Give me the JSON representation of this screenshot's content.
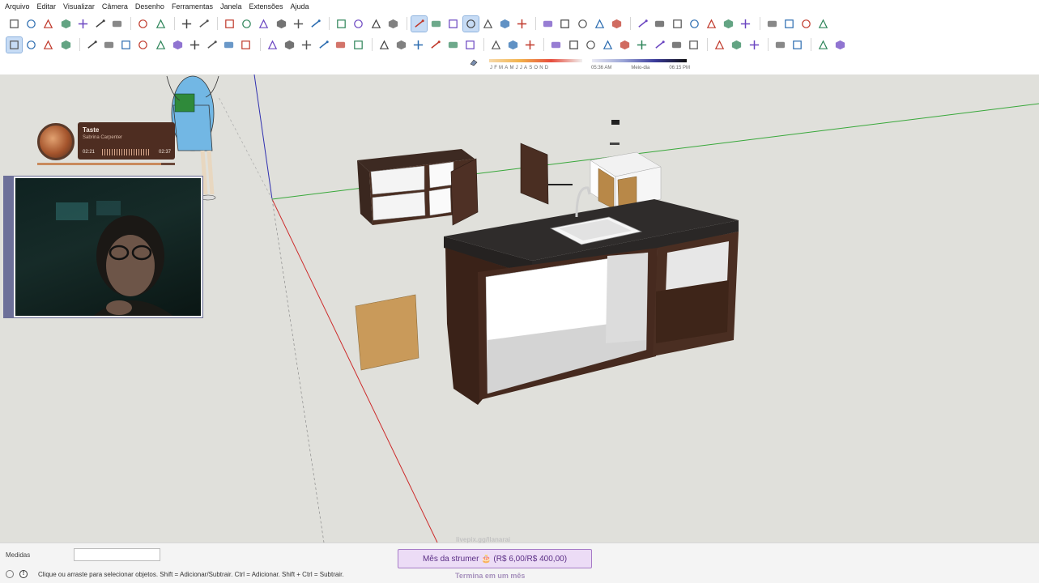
{
  "menu": [
    "Arquivo",
    "Editar",
    "Visualizar",
    "Câmera",
    "Desenho",
    "Ferramentas",
    "Janela",
    "Extensões",
    "Ajuda"
  ],
  "toolbar_top": [
    "new-file-icon",
    "open-folder-icon",
    "save-icon",
    "cut-icon",
    "copy-icon",
    "paste-icon",
    "erase-icon",
    "sep",
    "undo-icon",
    "redo-icon",
    "sep",
    "print-icon",
    "model-info-icon",
    "sep",
    "iso-view-icon",
    "top-view-icon",
    "front-view-icon",
    "right-view-icon",
    "back-view-icon",
    "left-view-icon",
    "sep",
    "orbit-icon",
    "pan-icon",
    "zoom-extents-icon",
    "section-plane-icon",
    "sep",
    "xray-icon",
    "back-edges-icon",
    "wireframe-icon",
    "hidden-line-icon",
    "shaded-icon",
    "textured-icon",
    "monochrome-icon",
    "sep",
    "solid-union-icon",
    "solid-subtract-icon",
    "solid-intersect-icon",
    "solid-trim-icon",
    "solid-split-icon",
    "sep",
    "warehouse-icon",
    "extension-icon",
    "component-icon",
    "material-icon",
    "style-icon",
    "cloud-icon",
    "settings-icon",
    "sep",
    "layout-icon",
    "info-icon",
    "cart-icon",
    "account-icon"
  ],
  "toolbar_bottom": [
    "select-icon",
    "component-icon",
    "paint-bucket-icon",
    "eraser-icon",
    "sep",
    "pencil-icon",
    "freehand-icon",
    "rectangle-icon",
    "rotated-rectangle-icon",
    "circle-icon",
    "polygon-icon",
    "arc-icon",
    "two-point-arc-icon",
    "three-point-arc-icon",
    "pie-icon",
    "sep",
    "move-icon",
    "push-pull-icon",
    "rotate-icon",
    "follow-me-icon",
    "scale-icon",
    "offset-icon",
    "sep",
    "tape-measure-icon",
    "dimension-icon",
    "protractor-icon",
    "text-icon",
    "axes-icon",
    "3d-text-icon",
    "sep",
    "sandbox-icon",
    "stamp-icon",
    "drape-icon",
    "sep",
    "section-icon",
    "section-cut-icon",
    "zoom-icon",
    "zoom-window-icon",
    "zoom-extents-icon",
    "previous-view-icon",
    "position-camera-icon",
    "look-around-icon",
    "walk-icon",
    "sep",
    "flip-icon",
    "box-icon",
    "solid-box-icon",
    "sep",
    "mirror-icon",
    "curve-icon",
    "sep",
    "panel-icon",
    "dashed-box-icon"
  ],
  "shadows": {
    "months": [
      "J",
      "F",
      "M",
      "A",
      "M",
      "J",
      "J",
      "A",
      "S",
      "O",
      "N",
      "D"
    ],
    "time_start": "05:36 AM",
    "time_mid": "Meio-dia",
    "time_end": "06:15 PM"
  },
  "now_playing": {
    "title": "Taste",
    "artist": "Sabrina Carpenter",
    "elapsed": "02:21",
    "duration": "02:37",
    "progress": 0.9
  },
  "measurements_label": "Medidas",
  "status_text": "Clique ou arraste para selecionar objetos. Shift = Adicionar/Subtrair. Ctrl = Adicionar. Shift + Ctrl = Subtrair.",
  "overlay": {
    "link_text": "livepix.gg/llanarai",
    "goal_text": "Mês da strumer 🎂 (R$ 6,00/R$ 400,00)",
    "goal_end": "Termina em um mês"
  },
  "colors": {
    "red_axis": "#cc2b2b",
    "green_axis": "#38a83a",
    "blue_axis": "#3030b0",
    "wood": "#4a2e22",
    "counter": "#2e2b2a",
    "accent": "#a77bc7"
  }
}
